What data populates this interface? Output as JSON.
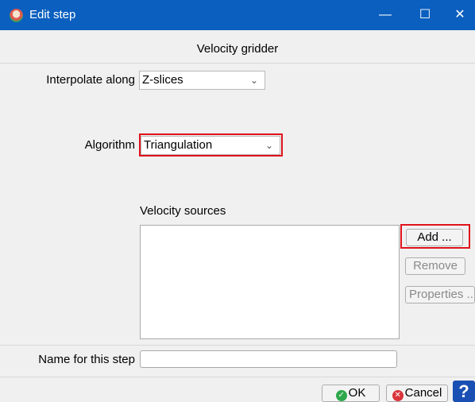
{
  "window": {
    "title": "Edit step",
    "minimize_glyph": "—",
    "maximize_glyph": "☐",
    "close_glyph": "✕"
  },
  "header": {
    "title": "Velocity gridder"
  },
  "interpolate": {
    "label": "Interpolate along",
    "value": "Z-slices"
  },
  "algorithm": {
    "label": "Algorithm",
    "value": "Triangulation"
  },
  "velocity_sources": {
    "label": "Velocity sources",
    "items": [],
    "add_label": "Add ...",
    "remove_label": "Remove",
    "properties_label": "Properties ..."
  },
  "step_name": {
    "label": "Name for this step",
    "value": ""
  },
  "footer": {
    "ok_label": "OK",
    "cancel_label": "Cancel",
    "help_glyph": "?"
  },
  "icons": {
    "app": "app-logo-icon",
    "ok": "check-circle-icon",
    "cancel": "x-circle-icon",
    "help": "help-icon",
    "dropdown": "chevron-down-icon"
  },
  "colors": {
    "titlebar": "#0a5fbf",
    "highlight": "#e0121b",
    "ok_icon": "#2ea84a",
    "cancel_icon": "#d9343a",
    "help_icon": "#1a4fb3"
  }
}
